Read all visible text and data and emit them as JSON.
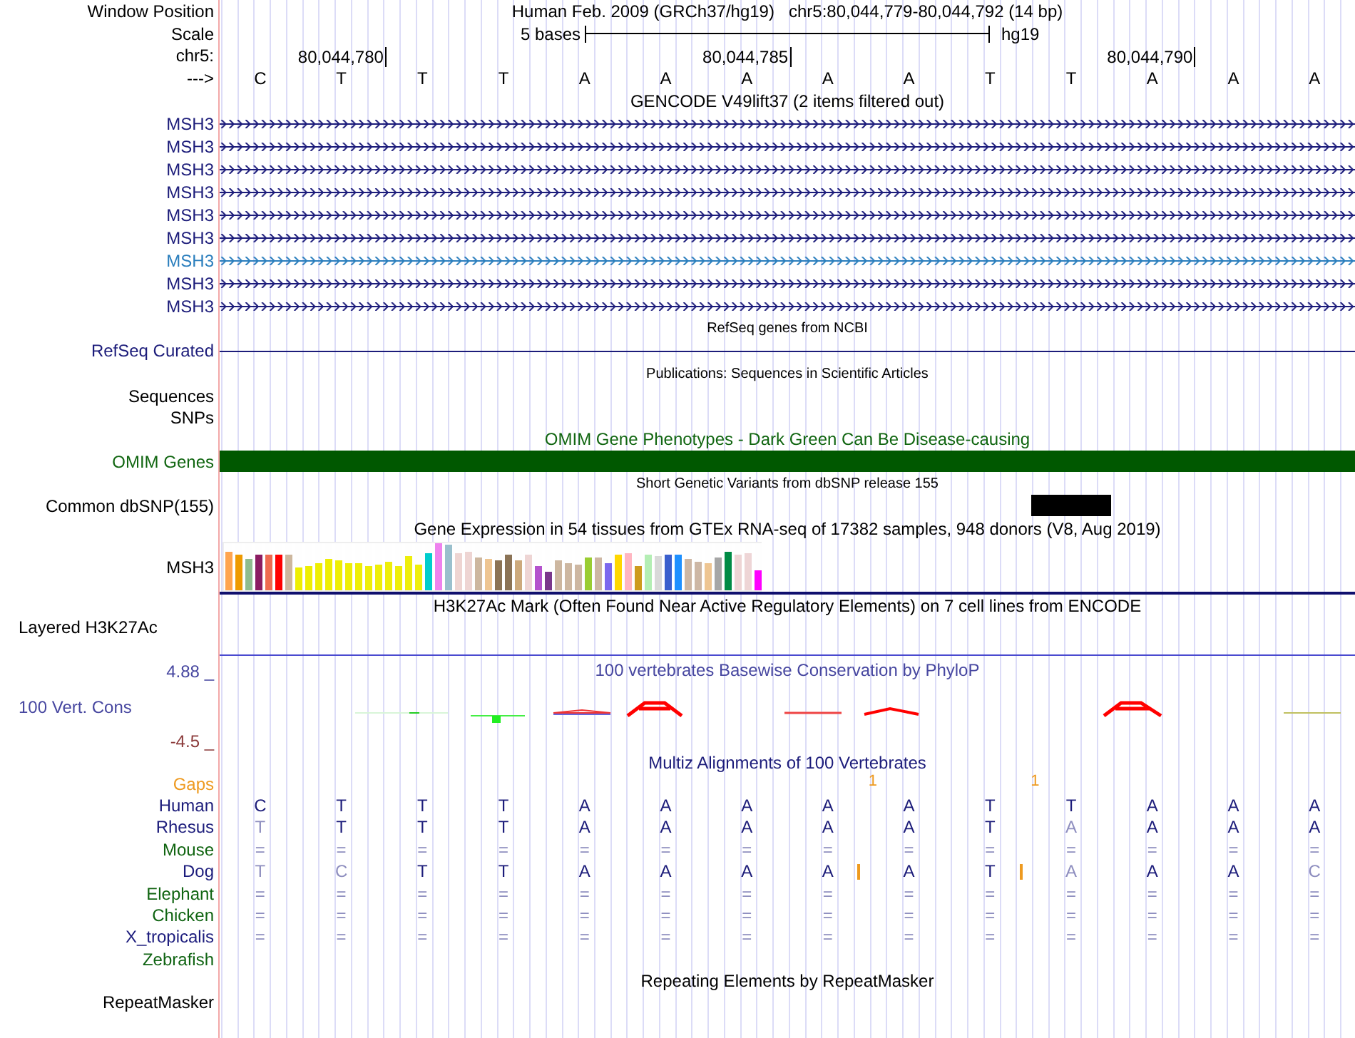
{
  "ruler": {
    "window_position_label": "Window Position",
    "assembly": "Human Feb. 2009 (GRCh37/hg19)",
    "position": "chr5:80,044,779-80,044,792 (14 bp)",
    "scale_label": "Scale",
    "scale_text": "5 bases",
    "scale_db": "hg19",
    "chrom_label": "chr5:",
    "strand_label": "--->",
    "bases": [
      {
        "base": "C"
      },
      {
        "base": "T",
        "coordinate": "80,044,780"
      },
      {
        "base": "T"
      },
      {
        "base": "T"
      },
      {
        "base": "A"
      },
      {
        "base": "A"
      },
      {
        "base": "A",
        "coordinate": "80,044,785"
      },
      {
        "base": "A"
      },
      {
        "base": "A"
      },
      {
        "base": "T"
      },
      {
        "base": "T"
      },
      {
        "base": "A",
        "coordinate": "80,044,790"
      },
      {
        "base": "A"
      },
      {
        "base": "A"
      }
    ]
  },
  "gencode": {
    "title": "GENCODE V49lift37 (2 items filtered out)",
    "genes": [
      {
        "name": "MSH3",
        "color": "#1c1c7a"
      },
      {
        "name": "MSH3",
        "color": "#1c1c7a"
      },
      {
        "name": "MSH3",
        "color": "#1c1c7a"
      },
      {
        "name": "MSH3",
        "color": "#1c1c7a"
      },
      {
        "name": "MSH3",
        "color": "#1c1c7a"
      },
      {
        "name": "MSH3",
        "color": "#1c1c7a"
      },
      {
        "name": "MSH3",
        "color": "#2a7ebd"
      },
      {
        "name": "MSH3",
        "color": "#1c1c7a"
      },
      {
        "name": "MSH3",
        "color": "#1c1c7a"
      }
    ]
  },
  "refseq": {
    "title": "RefSeq genes from NCBI",
    "label": "RefSeq Curated"
  },
  "publications": {
    "title": "Publications: Sequences in Scientific Articles",
    "labels": [
      "Sequences",
      "SNPs"
    ]
  },
  "omim": {
    "title": "OMIM Gene Phenotypes - Dark Green Can Be Disease-causing",
    "label": "OMIM Genes"
  },
  "dbsnp": {
    "title": "Short Genetic Variants from dbSNP release 155",
    "label": "Common dbSNP(155)",
    "positions": [
      {
        "variant": false
      },
      {
        "variant": false
      },
      {
        "variant": false
      },
      {
        "variant": false
      },
      {
        "variant": false
      },
      {
        "variant": false
      },
      {
        "variant": false
      },
      {
        "variant": false
      },
      {
        "variant": false
      },
      {
        "variant": false
      },
      {
        "variant": true
      },
      {
        "variant": false
      },
      {
        "variant": false
      },
      {
        "variant": false
      }
    ]
  },
  "gtex": {
    "title": "Gene Expression in 54 tissues from GTEx RNA-seq of 17382 samples, 948 donors (V8, Aug 2019)",
    "label": "MSH3",
    "tissues": [
      {
        "color": "#ffa54f",
        "level": 0.81
      },
      {
        "color": "#ee9a00",
        "level": 0.76
      },
      {
        "color": "#8fbc8f",
        "level": 0.67
      },
      {
        "color": "#8b1c62",
        "level": 0.75
      },
      {
        "color": "#ee6a50",
        "level": 0.75
      },
      {
        "color": "#ff0000",
        "level": 0.77
      },
      {
        "color": "#cdb79e",
        "level": 0.75
      },
      {
        "color": "#eeee00",
        "level": 0.5
      },
      {
        "color": "#eeee01",
        "level": 0.52
      },
      {
        "color": "#eeee02",
        "level": 0.57
      },
      {
        "color": "#eeee03",
        "level": 0.66
      },
      {
        "color": "#eeee04",
        "level": 0.63
      },
      {
        "color": "#eeee05",
        "level": 0.58
      },
      {
        "color": "#eeee06",
        "level": 0.59
      },
      {
        "color": "#eeee07",
        "level": 0.52
      },
      {
        "color": "#eeee08",
        "level": 0.56
      },
      {
        "color": "#eeee09",
        "level": 0.6
      },
      {
        "color": "#eeee0a",
        "level": 0.52
      },
      {
        "color": "#eeee0b",
        "level": 0.72
      },
      {
        "color": "#eeee0c",
        "level": 0.54
      },
      {
        "color": "#00cdcd",
        "level": 0.78
      },
      {
        "color": "#ee82ee",
        "level": 1.0
      },
      {
        "color": "#9ac0cd",
        "level": 0.97
      },
      {
        "color": "#eed5d2",
        "level": 0.78
      },
      {
        "color": "#eed5d3",
        "level": 0.81
      },
      {
        "color": "#cdb79f",
        "level": 0.7
      },
      {
        "color": "#eec591",
        "level": 0.66
      },
      {
        "color": "#8b7355",
        "level": 0.64
      },
      {
        "color": "#8b7356",
        "level": 0.75
      },
      {
        "color": "#cdaa7d",
        "level": 0.63
      },
      {
        "color": "#eed5d4",
        "level": 0.77
      },
      {
        "color": "#b452cd",
        "level": 0.51
      },
      {
        "color": "#7a378b",
        "level": 0.4
      },
      {
        "color": "#cdb7a0",
        "level": 0.63
      },
      {
        "color": "#cdb7a1",
        "level": 0.57
      },
      {
        "color": "#cdb7a2",
        "level": 0.55
      },
      {
        "color": "#9acd32",
        "level": 0.71
      },
      {
        "color": "#cdb7a3",
        "level": 0.71
      },
      {
        "color": "#7b68ee",
        "level": 0.57
      },
      {
        "color": "#ffd700",
        "level": 0.77
      },
      {
        "color": "#ffb6c1",
        "level": 0.8
      },
      {
        "color": "#cd9b1d",
        "level": 0.51
      },
      {
        "color": "#b4eeb4",
        "level": 0.75
      },
      {
        "color": "#d9d9d9",
        "level": 0.72
      },
      {
        "color": "#3a5fcd",
        "level": 0.77
      },
      {
        "color": "#1e90ff",
        "level": 0.77
      },
      {
        "color": "#cdb7a4",
        "level": 0.66
      },
      {
        "color": "#cdb7a5",
        "level": 0.6
      },
      {
        "color": "#eec592",
        "level": 0.57
      },
      {
        "color": "#a6a6a6",
        "level": 0.71
      },
      {
        "color": "#008b45",
        "level": 0.83
      },
      {
        "color": "#eed5d5",
        "level": 0.77
      },
      {
        "color": "#eed5d6",
        "level": 0.8
      },
      {
        "color": "#ff00ff",
        "level": 0.43
      }
    ]
  },
  "h3k27ac": {
    "title": "H3K27Ac Mark (Often Found Near Active Regulatory Elements) on 7 cell lines from ENCODE",
    "label": "Layered H3K27Ac"
  },
  "conservation": {
    "title": "100 vertebrates Basewise Conservation by PhyloP",
    "label": "100 Vert. Cons",
    "max_label": "4.88 _",
    "min_label": "-4.5 _"
  },
  "multiz": {
    "title": "Multiz Alignments of 100 Vertebrates",
    "gaps_label": "Gaps",
    "gaps": [
      {
        "insertion": false
      },
      {
        "insertion": false
      },
      {
        "insertion": false
      },
      {
        "insertion": false
      },
      {
        "insertion": false
      },
      {
        "insertion": false
      },
      {
        "insertion": false
      },
      {
        "insertion": false
      },
      {
        "insertion": true,
        "count": "1"
      },
      {
        "insertion": false
      },
      {
        "insertion": true,
        "count": "1"
      },
      {
        "insertion": false
      },
      {
        "insertion": false
      },
      {
        "insertion": false
      }
    ],
    "species": [
      {
        "name": "Human",
        "color": "#1c1c7a",
        "cells": [
          {
            "base": "C",
            "faded": false
          },
          {
            "base": "T",
            "faded": false
          },
          {
            "base": "T",
            "faded": false
          },
          {
            "base": "T",
            "faded": false
          },
          {
            "base": "A",
            "faded": false
          },
          {
            "base": "A",
            "faded": false
          },
          {
            "base": "A",
            "faded": false
          },
          {
            "base": "A",
            "faded": false
          },
          {
            "base": "A",
            "faded": false
          },
          {
            "base": "T",
            "faded": false
          },
          {
            "base": "T",
            "faded": false
          },
          {
            "base": "A",
            "faded": false
          },
          {
            "base": "A",
            "faded": false
          },
          {
            "base": "A",
            "faded": false
          }
        ]
      },
      {
        "name": "Rhesus",
        "color": "#1c1c7b",
        "cells": [
          {
            "base": "T",
            "faded": true
          },
          {
            "base": "T",
            "faded": false
          },
          {
            "base": "T",
            "faded": false
          },
          {
            "base": "T",
            "faded": false
          },
          {
            "base": "A",
            "faded": false
          },
          {
            "base": "A",
            "faded": false
          },
          {
            "base": "A",
            "faded": false
          },
          {
            "base": "A",
            "faded": false
          },
          {
            "base": "A",
            "faded": false
          },
          {
            "base": "T",
            "faded": false
          },
          {
            "base": "A",
            "faded": true
          },
          {
            "base": "A",
            "faded": false
          },
          {
            "base": "A",
            "faded": false
          },
          {
            "base": "A",
            "faded": false
          }
        ]
      },
      {
        "name": "Mouse",
        "color": "#106410",
        "cells": [
          {
            "base": "=",
            "faded": true
          },
          {
            "base": "=",
            "faded": true
          },
          {
            "base": "=",
            "faded": true
          },
          {
            "base": "=",
            "faded": true
          },
          {
            "base": "=",
            "faded": true
          },
          {
            "base": "=",
            "faded": true
          },
          {
            "base": "=",
            "faded": true
          },
          {
            "base": "=",
            "faded": true
          },
          {
            "base": "=",
            "faded": true
          },
          {
            "base": "=",
            "faded": true
          },
          {
            "base": "=",
            "faded": true
          },
          {
            "base": "=",
            "faded": true
          },
          {
            "base": "=",
            "faded": true
          },
          {
            "base": "=",
            "faded": true
          }
        ]
      },
      {
        "name": "Dog",
        "color": "#1c1c7c",
        "cells": [
          {
            "base": "T",
            "faded": true
          },
          {
            "base": "C",
            "faded": true
          },
          {
            "base": "T",
            "faded": false
          },
          {
            "base": "T",
            "faded": false
          },
          {
            "base": "A",
            "faded": false
          },
          {
            "base": "A",
            "faded": false
          },
          {
            "base": "A",
            "faded": false
          },
          {
            "base": "A",
            "faded": false
          },
          {
            "base": "A",
            "faded": false,
            "insertion": true
          },
          {
            "base": "T",
            "faded": false
          },
          {
            "base": "A",
            "faded": true,
            "insertion": true
          },
          {
            "base": "A",
            "faded": false
          },
          {
            "base": "A",
            "faded": false
          },
          {
            "base": "C",
            "faded": true
          }
        ]
      },
      {
        "name": "Elephant",
        "color": "#106411",
        "cells": [
          {
            "base": "=",
            "faded": true
          },
          {
            "base": "=",
            "faded": true
          },
          {
            "base": "=",
            "faded": true
          },
          {
            "base": "=",
            "faded": true
          },
          {
            "base": "=",
            "faded": true
          },
          {
            "base": "=",
            "faded": true
          },
          {
            "base": "=",
            "faded": true
          },
          {
            "base": "=",
            "faded": true
          },
          {
            "base": "=",
            "faded": true
          },
          {
            "base": "=",
            "faded": true
          },
          {
            "base": "=",
            "faded": true
          },
          {
            "base": "=",
            "faded": true
          },
          {
            "base": "=",
            "faded": true
          },
          {
            "base": "=",
            "faded": true
          }
        ]
      },
      {
        "name": "Chicken",
        "color": "#106412",
        "cells": [
          {
            "base": "=",
            "faded": true
          },
          {
            "base": "=",
            "faded": true
          },
          {
            "base": "=",
            "faded": true
          },
          {
            "base": "=",
            "faded": true
          },
          {
            "base": "=",
            "faded": true
          },
          {
            "base": "=",
            "faded": true
          },
          {
            "base": "=",
            "faded": true
          },
          {
            "base": "=",
            "faded": true
          },
          {
            "base": "=",
            "faded": true
          },
          {
            "base": "=",
            "faded": true
          },
          {
            "base": "=",
            "faded": true
          },
          {
            "base": "=",
            "faded": true
          },
          {
            "base": "=",
            "faded": true
          },
          {
            "base": "=",
            "faded": true
          }
        ]
      },
      {
        "name": "X_tropicalis",
        "color": "#1c1c7d",
        "cells": [
          {
            "base": "=",
            "faded": true
          },
          {
            "base": "=",
            "faded": true
          },
          {
            "base": "=",
            "faded": true
          },
          {
            "base": "=",
            "faded": true
          },
          {
            "base": "=",
            "faded": true
          },
          {
            "base": "=",
            "faded": true
          },
          {
            "base": "=",
            "faded": true
          },
          {
            "base": "=",
            "faded": true
          },
          {
            "base": "=",
            "faded": true
          },
          {
            "base": "=",
            "faded": true
          },
          {
            "base": "=",
            "faded": true
          },
          {
            "base": "=",
            "faded": true
          },
          {
            "base": "=",
            "faded": true
          },
          {
            "base": "=",
            "faded": true
          }
        ]
      },
      {
        "name": "Zebrafish",
        "color": "#106413"
      }
    ]
  },
  "repeatmasker": {
    "title": "Repeating Elements by RepeatMasker",
    "label": "RepeatMasker"
  }
}
